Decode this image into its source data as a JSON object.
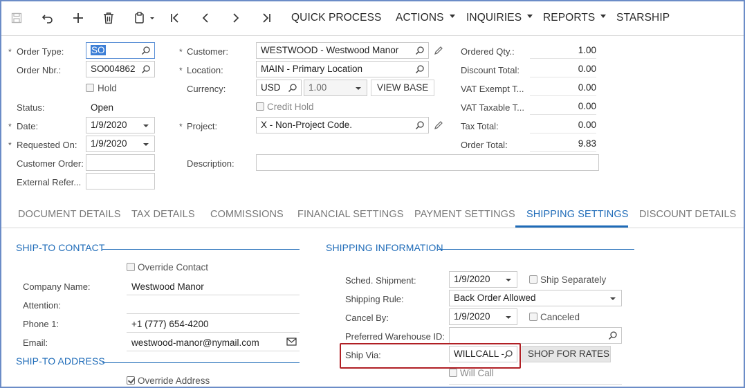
{
  "toolbar": {
    "menus": [
      "QUICK PROCESS",
      "ACTIONS",
      "INQUIRIES",
      "REPORTS",
      "STARSHIP"
    ]
  },
  "header": {
    "order_type": {
      "label": "Order Type:",
      "value": "SO"
    },
    "order_nbr": {
      "label": "Order Nbr.:",
      "value": "SO004862"
    },
    "hold": {
      "label": "Hold",
      "checked": false
    },
    "status": {
      "label": "Status:",
      "value": "Open"
    },
    "date": {
      "label": "Date:",
      "value": "1/9/2020"
    },
    "requested_on": {
      "label": "Requested On:",
      "value": "1/9/2020"
    },
    "customer_order": {
      "label": "Customer Order:",
      "value": ""
    },
    "external_ref": {
      "label": "External Refer...",
      "value": ""
    },
    "customer": {
      "label": "Customer:",
      "value": "WESTWOOD - Westwood Manor"
    },
    "location": {
      "label": "Location:",
      "value": "MAIN - Primary Location"
    },
    "currency": {
      "label": "Currency:",
      "value": "USD",
      "rate": "1.00",
      "view_base": "VIEW BASE"
    },
    "credit_hold": {
      "label": "Credit Hold",
      "checked": false
    },
    "project": {
      "label": "Project:",
      "value": "X - Non-Project Code."
    },
    "description": {
      "label": "Description:",
      "value": ""
    }
  },
  "totals": [
    {
      "label": "Ordered Qty.:",
      "value": "1.00"
    },
    {
      "label": "Discount Total:",
      "value": "0.00"
    },
    {
      "label": "VAT Exempt T...",
      "value": "0.00"
    },
    {
      "label": "VAT Taxable T...",
      "value": "0.00"
    },
    {
      "label": "Tax Total:",
      "value": "0.00"
    },
    {
      "label": "Order Total:",
      "value": "9.83"
    }
  ],
  "tabs": [
    {
      "label": "DOCUMENT DETAILS",
      "active": false
    },
    {
      "label": "TAX DETAILS",
      "active": false
    },
    {
      "label": "COMMISSIONS",
      "active": false
    },
    {
      "label": "FINANCIAL SETTINGS",
      "active": false
    },
    {
      "label": "PAYMENT SETTINGS",
      "active": false
    },
    {
      "label": "SHIPPING SETTINGS",
      "active": true
    },
    {
      "label": "DISCOUNT DETAILS",
      "active": false
    }
  ],
  "ship_to_contact": {
    "title": "SHIP-TO CONTACT",
    "override_contact": {
      "label": "Override Contact",
      "checked": false
    },
    "company_name": {
      "label": "Company Name:",
      "value": "Westwood Manor"
    },
    "attention": {
      "label": "Attention:",
      "value": ""
    },
    "phone1": {
      "label": "Phone 1:",
      "value": "+1 (777) 654-4200"
    },
    "email": {
      "label": "Email:",
      "value": "westwood-manor@nymail.com"
    }
  },
  "ship_to_address": {
    "title": "SHIP-TO ADDRESS",
    "override_address": {
      "label": "Override Address",
      "checked": true
    }
  },
  "shipping_info": {
    "title": "SHIPPING INFORMATION",
    "sched_shipment": {
      "label": "Sched. Shipment:",
      "value": "1/9/2020"
    },
    "ship_separately": {
      "label": "Ship Separately",
      "checked": false
    },
    "shipping_rule": {
      "label": "Shipping Rule:",
      "value": "Back Order Allowed"
    },
    "cancel_by": {
      "label": "Cancel By:",
      "value": "1/9/2020"
    },
    "canceled": {
      "label": "Canceled",
      "checked": false
    },
    "preferred_warehouse": {
      "label": "Preferred Warehouse ID:",
      "value": ""
    },
    "ship_via": {
      "label": "Ship Via:",
      "value": "WILLCALL -"
    },
    "shop_for_rates": "SHOP FOR RATES",
    "will_call": {
      "label": "Will Call",
      "checked": false
    }
  },
  "colors": {
    "accent": "#1e6bb8",
    "highlight": "#b01f24",
    "frame": "#6b8cc7"
  }
}
